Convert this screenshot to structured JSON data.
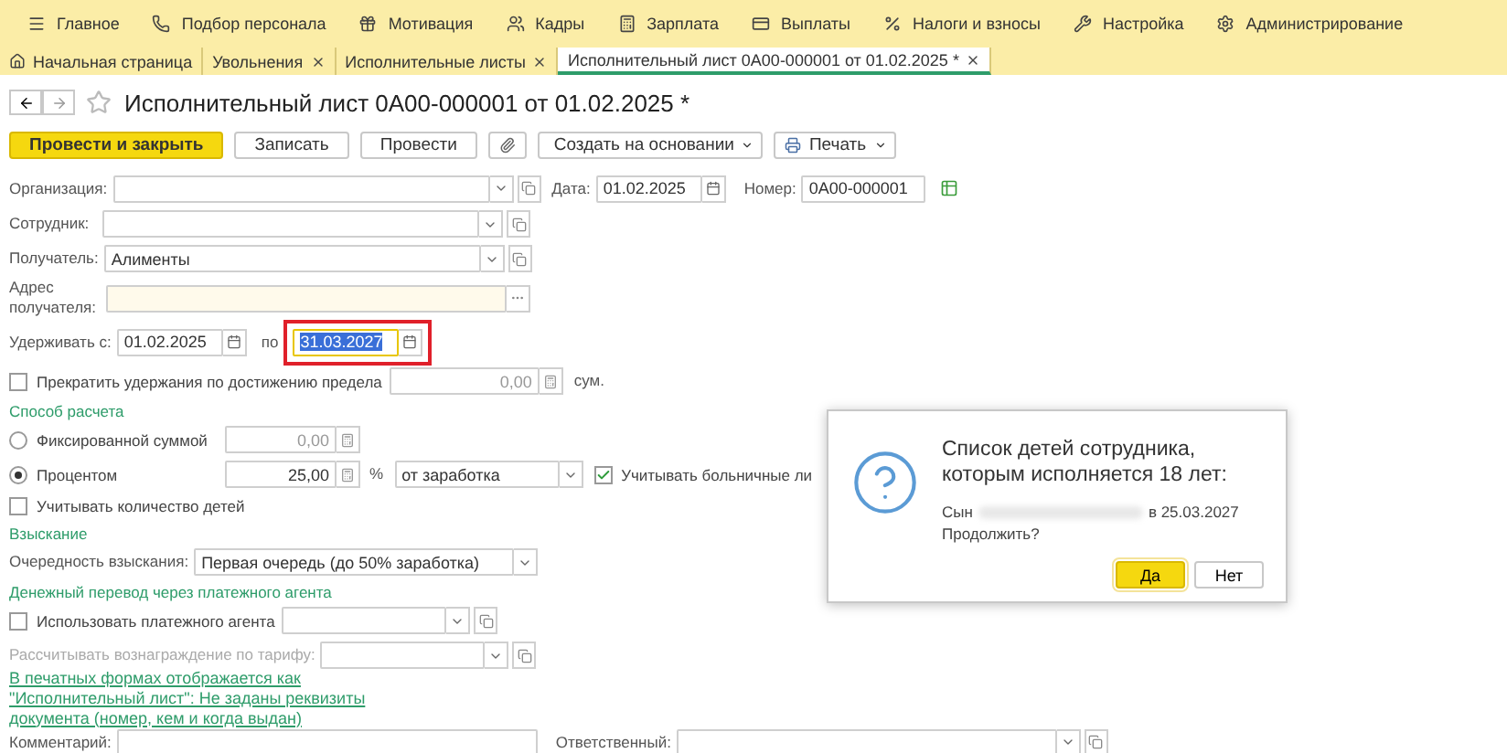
{
  "menu": [
    {
      "label": "Главное"
    },
    {
      "label": "Подбор персонала"
    },
    {
      "label": "Мотивация"
    },
    {
      "label": "Кадры"
    },
    {
      "label": "Зарплата"
    },
    {
      "label": "Выплаты"
    },
    {
      "label": "Налоги и взносы"
    },
    {
      "label": "Настройка"
    },
    {
      "label": "Администрирование"
    }
  ],
  "tabs": [
    {
      "label": "Начальная страница",
      "kind": "home",
      "selected": false
    },
    {
      "label": "Увольнения",
      "kind": "doc",
      "selected": false
    },
    {
      "label": "Исполнительные листы",
      "kind": "doc",
      "selected": false
    },
    {
      "label": "Исполнительный лист 0A00-000001 от 01.02.2025 *",
      "kind": "doc",
      "selected": true
    }
  ],
  "document": {
    "title": "Исполнительный лист 0A00-000001 от 01.02.2025 *",
    "starred": false
  },
  "toolbar": [
    {
      "kind": "primary",
      "label": "Провести и закрыть"
    },
    {
      "kind": "plain",
      "label": "Записать"
    },
    {
      "kind": "plain",
      "label": "Провести"
    },
    {
      "kind": "attach"
    },
    {
      "kind": "menu",
      "label": "Создать на основании"
    },
    {
      "kind": "print",
      "label": "Печать"
    }
  ],
  "form": {
    "organization": {
      "label": "Организация:"
    },
    "date": {
      "label": "Дата:",
      "value": "01.02.2025"
    },
    "number": {
      "label": "Номер:",
      "value": "0A00-000001"
    },
    "employee": {
      "label": "Сотрудник:"
    },
    "recipient": {
      "label": "Получатель:",
      "value": "Алименты"
    },
    "address": {
      "label": "Адрес получателя:"
    },
    "withhold_from": {
      "label": "Удерживать с:",
      "value": "01.02.2025"
    },
    "withhold_to": {
      "label": "по",
      "value": "31.03.2027",
      "highlighted": true
    },
    "stop_at_limit": {
      "label": "Прекратить удержания по достижению предела",
      "checked": false,
      "value": "0,00",
      "unit": "сум."
    },
    "calc_section": "Способ расчета",
    "fixed": {
      "label": "Фиксированной суммой",
      "selected": false,
      "value": "0,00"
    },
    "percent": {
      "label": "Процентом",
      "selected": true,
      "value": "25,00",
      "unit": "%",
      "base": "от заработка"
    },
    "sick_leave": {
      "label": "Учитывать больничные ли",
      "checked": true
    },
    "children": {
      "label": "Учитывать количество детей",
      "checked": false
    },
    "collection_section": "Взыскание",
    "priority": {
      "label": "Очередность взыскания:",
      "value": "Первая очередь (до 50% заработка)"
    },
    "transfer_section": "Денежный перевод через платежного агента",
    "use_agent": {
      "label": "Использовать платежного агента",
      "checked": false
    },
    "tariff": {
      "label": "Рассчитывать вознаграждение по тарифу:",
      "disabled": true
    },
    "print_link": "В печатных формах отображается как \"Исполнительный лист\": Не заданы реквизиты документа (номер, кем и когда выдан)",
    "comment": {
      "label": "Комментарий:"
    },
    "responsible": {
      "label": "Ответственный:"
    }
  },
  "dialog": {
    "title": "Список детей сотрудника, которым исполняется 18 лет:",
    "message_start": "Сын",
    "message_end": "в 25.03.2027",
    "question": "Продолжить?",
    "buttons": [
      {
        "label": "Да",
        "default": true
      },
      {
        "label": "Нет",
        "default": false
      }
    ]
  }
}
